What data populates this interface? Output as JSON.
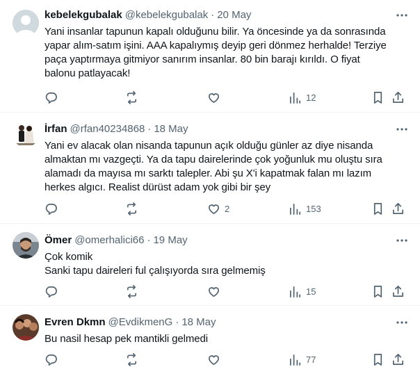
{
  "tweets": [
    {
      "name": "kebelekgubalak",
      "handle": "@kebelekgubalak",
      "separator": "·",
      "date": "20 May",
      "lines": [
        "Yani insanlar tapunun kapalı olduğunu bilir. Ya öncesinde ya da sonrasında",
        "yapar alım-satım işini. AAA kapalıymış deyip geri dönmez herhalde! Terziye",
        "paça yaptırmaya gitmiyor sanırım insanlar.  80 bin barajı kırıldı. O fiyat",
        "balonu patlayacak!"
      ],
      "likes": "",
      "views": "12",
      "avatar": "default-avatar"
    },
    {
      "name": "İrfan",
      "handle": "@rfan40234868",
      "separator": "·",
      "date": "18 May",
      "lines": [
        "Yani ev alacak olan nisanda tapunun açık olduğu günler az diye nisanda",
        "almaktan mı vazgeçti. Ya da tapu dairelerinde çok yoğunluk mu oluştu sıra",
        "alamadı da mayısa mı sarktı talepler. Abi şu X'i kapatmak falan mı lazım",
        "herkes algıcı. Realist dürüst adam yok gibi bir şey"
      ],
      "likes": "2",
      "views": "153",
      "avatar": "couple-photo"
    },
    {
      "name": "Ömer",
      "handle": "@omerhalici66",
      "separator": "·",
      "date": "19 May",
      "lines": [
        "Çok komik",
        "Sanki tapu daireleri ful çalışıyorda sıra gelmemiş"
      ],
      "likes": "",
      "views": "15",
      "avatar": "man-photo"
    },
    {
      "name": "Evren Dkmn",
      "handle": "@EvdikmenG",
      "separator": "·",
      "date": "18 May",
      "lines": [
        "Bu nasil hesap pek mantikli gelmedi"
      ],
      "likes": "",
      "views": "77",
      "avatar": "group-photo"
    }
  ],
  "icons": [
    "more-icon",
    "reply-icon",
    "retweet-icon",
    "like-icon",
    "views-icon",
    "bookmark-icon",
    "share-icon"
  ],
  "colors": {
    "text": "#0f1419",
    "secondary": "#536471",
    "border": "#eff3f4"
  }
}
